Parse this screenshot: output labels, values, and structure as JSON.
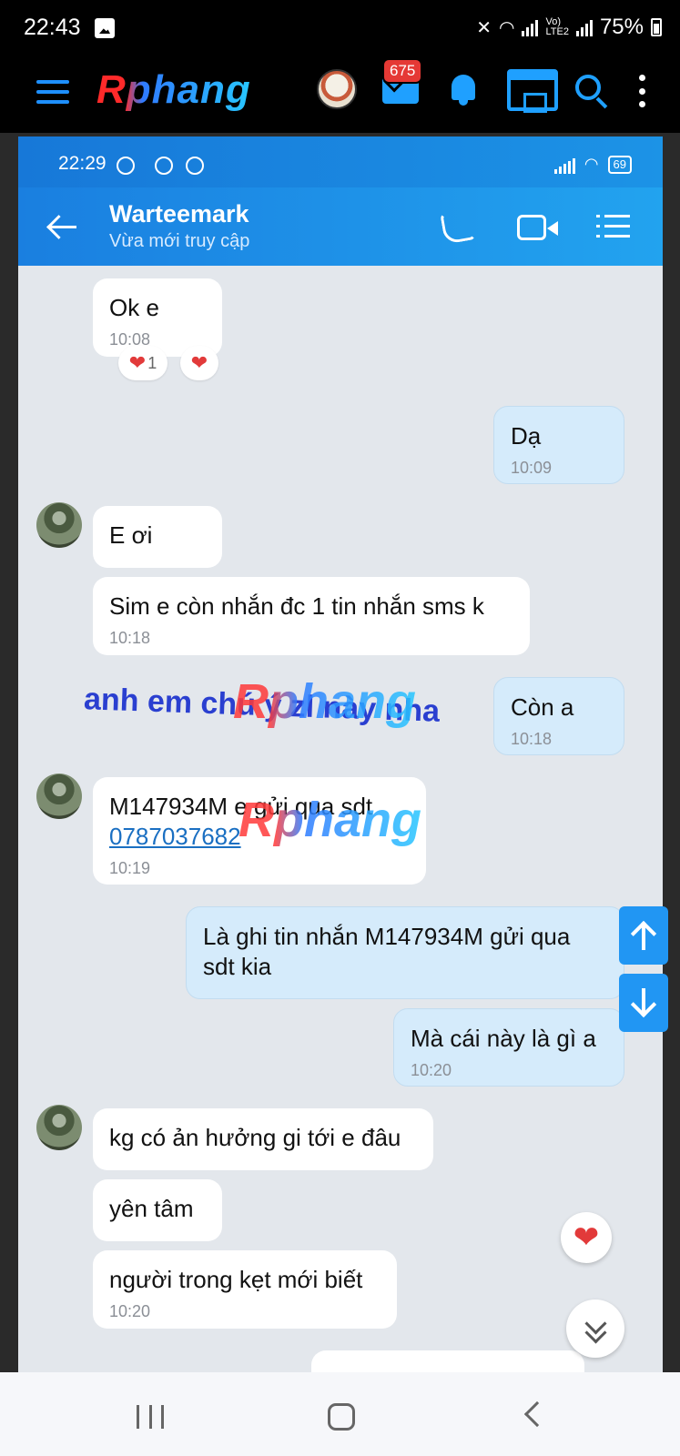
{
  "status": {
    "time": "22:43",
    "battery": "75%"
  },
  "appbar": {
    "logo": "Rphang",
    "mail_badge": "675"
  },
  "inner_status": {
    "time": "22:29",
    "battery": "69"
  },
  "chat": {
    "contact_name": "Warteemark",
    "contact_status": "Vừa mới truy cập",
    "messages": [
      {
        "dir": "in",
        "text": "Ok e",
        "time": "10:08"
      },
      {
        "dir": "out",
        "text": "Dạ",
        "time": "10:09"
      },
      {
        "dir": "in",
        "text": "E ơi",
        "time": ""
      },
      {
        "dir": "in",
        "text": "Sim e còn nhắn đc 1 tin nhắn sms k",
        "time": "10:18"
      },
      {
        "dir": "out",
        "text": "Còn a",
        "time": "10:18"
      },
      {
        "dir": "in",
        "text": "M147934M  e gửi qua sdt",
        "link": "0787037682",
        "time": "10:19"
      },
      {
        "dir": "out",
        "text": "Là ghi tin nhắn M147934M gửi qua sdt kia",
        "time": ""
      },
      {
        "dir": "out",
        "text": "Mà cái này là gì a",
        "time": "10:20"
      },
      {
        "dir": "in",
        "text": "kg có ản hưởng gi tới e đâu",
        "time": ""
      },
      {
        "dir": "in",
        "text": "yên tâm",
        "time": ""
      },
      {
        "dir": "in",
        "text": "người trong kẹt mới biết",
        "time": "10:20"
      }
    ],
    "reactions": {
      "first_count": "1"
    }
  },
  "watermark": {
    "caption": "anh em chú ý zl này nha",
    "logo": "Rphang"
  },
  "icons": {
    "menu": "hamburger-icon",
    "mail": "mail-icon",
    "bell": "bell-icon",
    "store": "store-icon",
    "search": "search-icon",
    "more": "more-vert-icon",
    "back": "back-arrow-icon",
    "call": "phone-icon",
    "video": "video-icon",
    "list": "list-icon"
  },
  "colors": {
    "header_blue": "#1a7fe0",
    "out_bubble": "#d5ebfb",
    "in_bubble": "#ffffff",
    "chat_bg": "#e3e7ec",
    "accent": "#2196f3"
  }
}
